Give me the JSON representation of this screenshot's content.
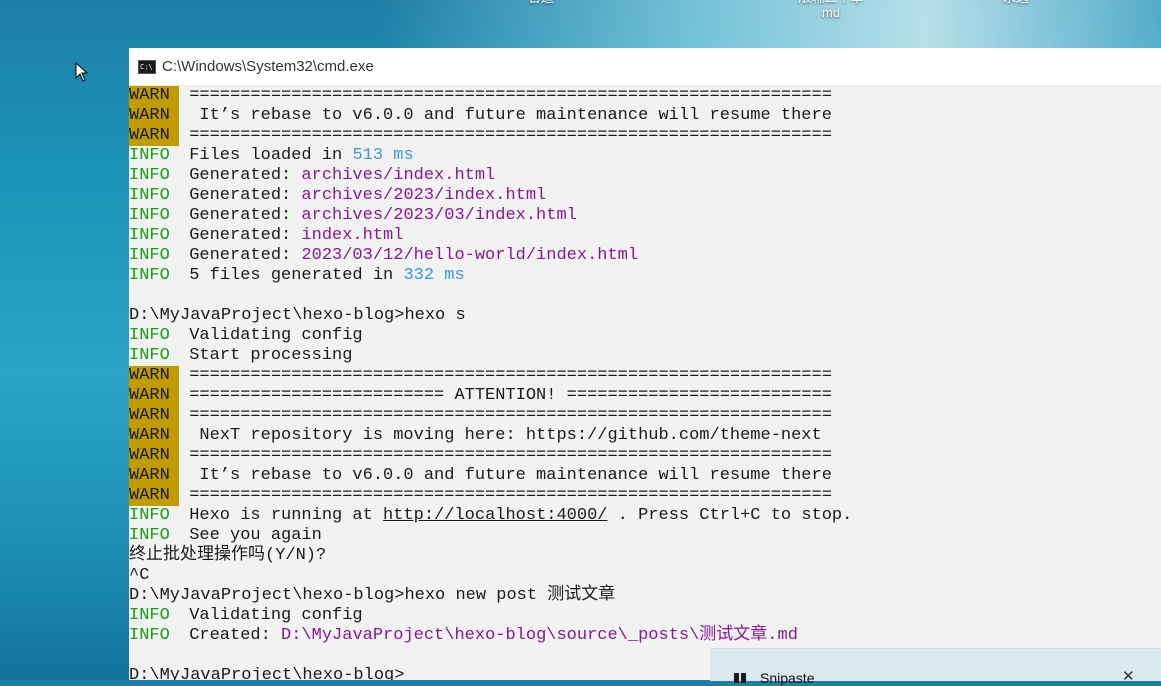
{
  "desktop": {
    "labels": [
      "合适",
      "版辅二个单\nmd",
      "永远"
    ]
  },
  "window": {
    "title": "C:\\Windows\\System32\\cmd.exe"
  },
  "console_lines": [
    {
      "tag": "WARN",
      "segments": [
        {
          "t": " ===============================================================",
          "c": ""
        }
      ]
    },
    {
      "tag": "WARN",
      "segments": [
        {
          "t": "  It’s rebase to v6.0.0 and future maintenance will resume there",
          "c": ""
        }
      ]
    },
    {
      "tag": "WARN",
      "segments": [
        {
          "t": " ===============================================================",
          "c": ""
        }
      ]
    },
    {
      "tag": "INFO",
      "segments": [
        {
          "t": " Files loaded in ",
          "c": ""
        },
        {
          "t": "513 ms",
          "c": "num"
        }
      ]
    },
    {
      "tag": "INFO",
      "segments": [
        {
          "t": " Generated: ",
          "c": ""
        },
        {
          "t": "archives/index.html",
          "c": "path"
        }
      ]
    },
    {
      "tag": "INFO",
      "segments": [
        {
          "t": " Generated: ",
          "c": ""
        },
        {
          "t": "archives/2023/index.html",
          "c": "path"
        }
      ]
    },
    {
      "tag": "INFO",
      "segments": [
        {
          "t": " Generated: ",
          "c": ""
        },
        {
          "t": "archives/2023/03/index.html",
          "c": "path"
        }
      ]
    },
    {
      "tag": "INFO",
      "segments": [
        {
          "t": " Generated: ",
          "c": ""
        },
        {
          "t": "index.html",
          "c": "path"
        }
      ]
    },
    {
      "tag": "INFO",
      "segments": [
        {
          "t": " Generated: ",
          "c": ""
        },
        {
          "t": "2023/03/12/hello-world/index.html",
          "c": "path"
        }
      ]
    },
    {
      "tag": "INFO",
      "segments": [
        {
          "t": " 5 files generated in ",
          "c": ""
        },
        {
          "t": "332 ms",
          "c": "num"
        }
      ]
    },
    {
      "tag": "",
      "segments": []
    },
    {
      "tag": "",
      "segments": [
        {
          "t": "D:\\MyJavaProject\\hexo-blog>hexo s",
          "c": ""
        }
      ]
    },
    {
      "tag": "INFO",
      "segments": [
        {
          "t": " Validating config",
          "c": ""
        }
      ]
    },
    {
      "tag": "INFO",
      "segments": [
        {
          "t": " Start processing",
          "c": ""
        }
      ]
    },
    {
      "tag": "WARN",
      "segments": [
        {
          "t": " ===============================================================",
          "c": ""
        }
      ]
    },
    {
      "tag": "WARN",
      "segments": [
        {
          "t": " ========================= ATTENTION! ==========================",
          "c": ""
        }
      ]
    },
    {
      "tag": "WARN",
      "segments": [
        {
          "t": " ===============================================================",
          "c": ""
        }
      ]
    },
    {
      "tag": "WARN",
      "segments": [
        {
          "t": "  NexT repository is moving here: https://github.com/theme-next",
          "c": ""
        }
      ]
    },
    {
      "tag": "WARN",
      "segments": [
        {
          "t": " ===============================================================",
          "c": ""
        }
      ]
    },
    {
      "tag": "WARN",
      "segments": [
        {
          "t": "  It’s rebase to v6.0.0 and future maintenance will resume there",
          "c": ""
        }
      ]
    },
    {
      "tag": "WARN",
      "segments": [
        {
          "t": " ===============================================================",
          "c": ""
        }
      ]
    },
    {
      "tag": "INFO",
      "segments": [
        {
          "t": " Hexo is running at ",
          "c": ""
        },
        {
          "t": "http://localhost:4000/",
          "c": "link"
        },
        {
          "t": " . Press Ctrl+C to stop.",
          "c": ""
        }
      ]
    },
    {
      "tag": "INFO",
      "segments": [
        {
          "t": " See you again",
          "c": ""
        }
      ]
    },
    {
      "tag": "",
      "segments": [
        {
          "t": "终止批处理操作吗(Y/N)?",
          "c": ""
        }
      ]
    },
    {
      "tag": "",
      "segments": [
        {
          "t": "^C",
          "c": ""
        }
      ]
    },
    {
      "tag": "",
      "segments": [
        {
          "t": "D:\\MyJavaProject\\hexo-blog>hexo new post 测试文章",
          "c": ""
        }
      ]
    },
    {
      "tag": "INFO",
      "segments": [
        {
          "t": " Validating config",
          "c": ""
        }
      ]
    },
    {
      "tag": "INFO",
      "segments": [
        {
          "t": " Created: ",
          "c": ""
        },
        {
          "t": "D:\\MyJavaProject\\hexo-blog\\source\\_posts\\测试文章.md",
          "c": "path"
        }
      ]
    },
    {
      "tag": "",
      "segments": []
    },
    {
      "tag": "",
      "segments": [
        {
          "t": "D:\\MyJavaProject\\hexo-blog>",
          "c": ""
        }
      ]
    }
  ],
  "snipaste": {
    "title": "Snipaste",
    "close_glyph": "✕"
  },
  "colors": {
    "warn_bg": "#c19c00",
    "info": "#13a10e",
    "number": "#3a96dd",
    "path": "#881798"
  }
}
